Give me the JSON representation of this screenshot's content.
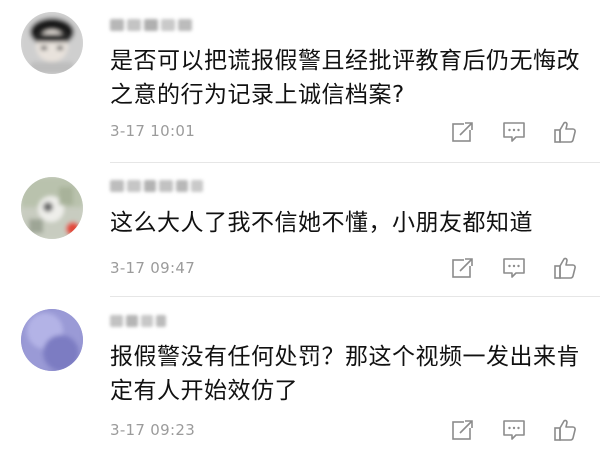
{
  "comments": [
    {
      "text": "是否可以把谎报假警且经批评教育后仍无悔改之意的行为记录上诚信档案?",
      "time": "3-17 10:01"
    },
    {
      "text": "这么大人了我不信她不懂，小朋友都知道",
      "time": "3-17 09:47"
    },
    {
      "text": "报假警没有任何处罚？那这个视频一发出来肯定有人开始效仿了",
      "time": "3-17 09:23"
    }
  ],
  "icons": {
    "share": "share-icon",
    "reply": "comment-icon",
    "like": "thumbs-up-icon"
  },
  "colors": {
    "text": "#111111",
    "meta": "#9b9b9b",
    "icon": "#8c8c8c",
    "divider": "#e6e6e6"
  }
}
